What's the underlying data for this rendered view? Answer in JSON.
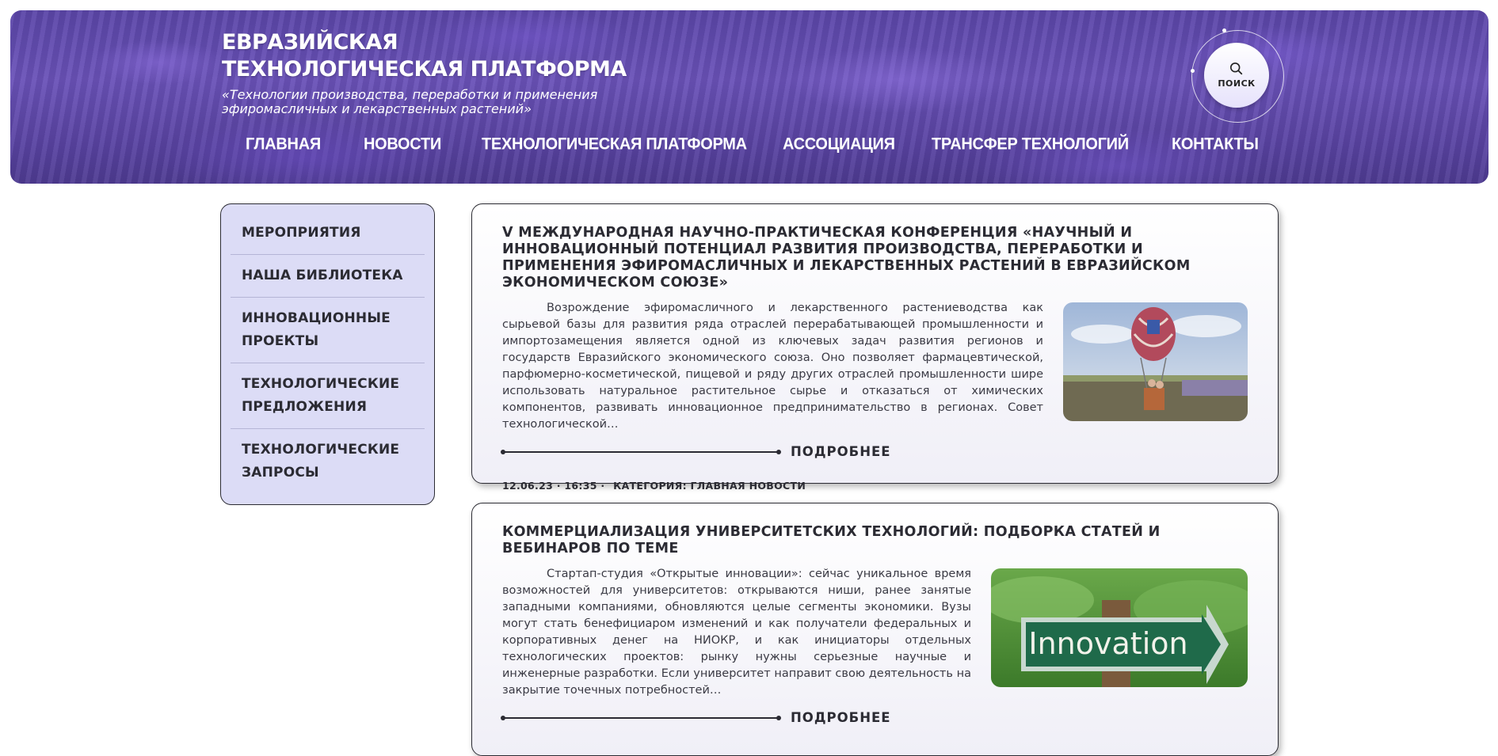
{
  "header": {
    "title": "ЕВРАЗИЙСКАЯ ТЕХНОЛОГИЧЕСКАЯ ПЛАТФОРМА",
    "subtitle": "«Технологии производства, переработки и применения эфиромасличных и лекарственных растений»",
    "search_label": "ПОИСК",
    "nav": [
      "ГЛАВНАЯ",
      "НОВОСТИ",
      "ТЕХНОЛОГИЧЕСКАЯ  ПЛАТФОРМА",
      "АССОЦИАЦИЯ",
      "ТРАНСФЕР  ТЕХНОЛОГИЙ",
      "КОНТАКТЫ"
    ]
  },
  "sidebar": {
    "items": [
      "МЕРОПРИЯТИЯ",
      "НАША БИБЛИОТЕКА",
      "ИННОВАЦИОННЫЕ ПРОЕКТЫ",
      "ТЕХНОЛОГИЧЕСКИЕ ПРЕДЛОЖЕНИЯ",
      "ТЕХНОЛОГИЧЕСКИЕ ЗАПРОСЫ"
    ]
  },
  "posts": [
    {
      "title": "V МЕЖДУНАРОДНАЯ НАУЧНО-ПРАКТИЧЕСКАЯ КОНФЕРЕНЦИЯ «НАУЧНЫЙ И ИННОВАЦИОННЫЙ ПОТЕНЦИАЛ РАЗВИТИЯ ПРОИЗВОДСТВА, ПЕРЕРАБОТКИ И ПРИМЕНЕНИЯ ЭФИРОМАСЛИЧНЫХ И ЛЕКАРСТВЕННЫХ РАСТЕНИЙ В ЕВРАЗИЙСКОМ ЭКОНОМИЧЕСКОМ СОЮЗЕ»",
      "excerpt": "Возрождение эфиромасличного и лекарственного растениеводства как сырьевой базы для развития ряда отраслей перерабатывающей промышленности и импортозамещения является одной из ключевых задач развития регионов и государств Евразийского экономического союза.  Оно позволяет фармацевтической, парфюмерно-косметической, пищевой и ряду других отраслей промышленности шире использовать натуральное растительное сырье и отказаться от химических компонентов, развивать инновационное предпринимательство в регионах.  Совет технологической…",
      "more_label": "ПОДРОБНЕЕ",
      "date": "12.06.23 · 16:35 ·",
      "category": "КАТЕГОРИЯ: ГЛАВНАЯ  НОВОСТИ"
    },
    {
      "title": "КОММЕРЦИАЛИЗАЦИЯ УНИВЕРСИТЕТСКИХ ТЕХНОЛОГИЙ: ПОДБОРКА СТАТЕЙ И ВЕБИНАРОВ ПО ТЕМЕ",
      "excerpt": "Стартап-студия «Открытые инновации»: сейчас уникальное время возможностей для университетов: открываются ниши, ранее занятые западными компаниями, обновляются целые сегменты экономики. Вузы могут стать бенефициаром изменений и как получатели федеральных и корпоративных денег на НИОКР, и как инициаторы отдельных технологических проектов: рынку нужны серьезные научные и инженерные разработки. Если университет направит свою деятельность на закрытие точечных потребностей…",
      "more_label": "ПОДРОБНЕЕ",
      "image_text": "Innovation"
    }
  ]
}
